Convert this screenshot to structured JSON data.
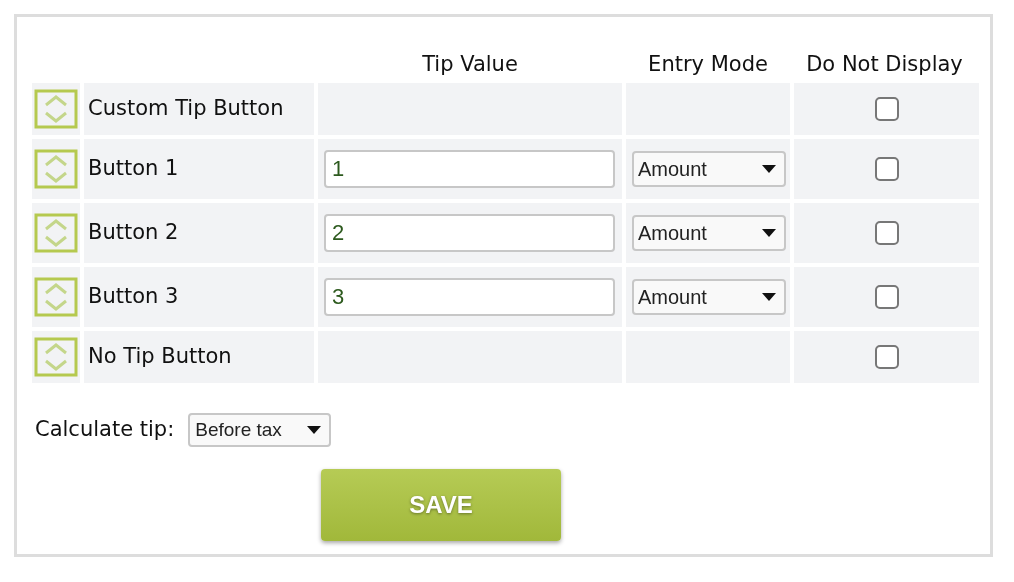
{
  "columns": [
    "Tip Value",
    "Entry Mode",
    "Do Not Display"
  ],
  "rows": [
    {
      "kind": "fixed",
      "label": "Custom Tip Button",
      "do_not_display": false
    },
    {
      "kind": "editable",
      "label": "Button 1",
      "tip_value": "1",
      "entry_mode": "Amount",
      "do_not_display": false
    },
    {
      "kind": "editable",
      "label": "Button 2",
      "tip_value": "2",
      "entry_mode": "Amount",
      "do_not_display": false
    },
    {
      "kind": "editable",
      "label": "Button 3",
      "tip_value": "3",
      "entry_mode": "Amount",
      "do_not_display": false
    },
    {
      "kind": "fixed",
      "label": "No Tip Button",
      "do_not_display": false
    }
  ],
  "calculate_tip": {
    "label": "Calculate tip:",
    "value": "Before tax"
  },
  "save_button": "SAVE"
}
